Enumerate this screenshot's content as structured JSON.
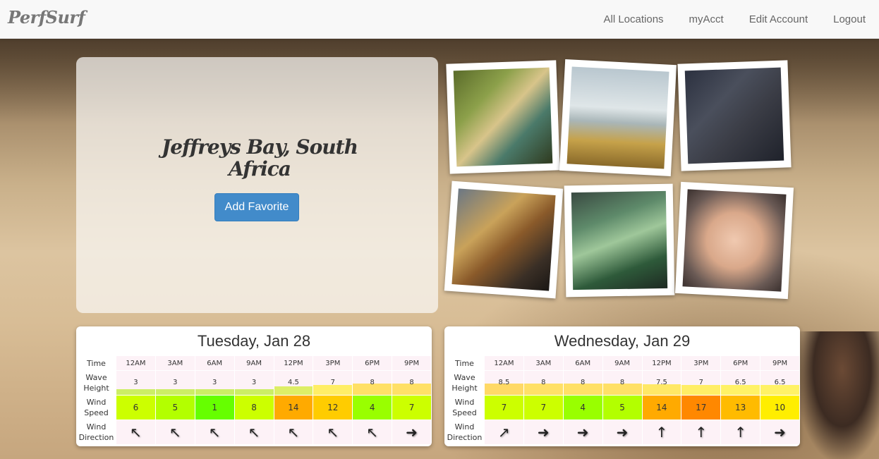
{
  "nav": {
    "brand": "PerfSurf",
    "links": [
      "All Locations",
      "myAcct",
      "Edit Account",
      "Logout"
    ]
  },
  "hero": {
    "location": "Jeffreys Bay, South Africa",
    "button_label": "Add Favorite"
  },
  "row_labels": {
    "time": "Time",
    "wave_height": "Wave Height",
    "wind_speed": "Wind Speed",
    "wind_direction": "Wind Direction"
  },
  "forecasts": [
    {
      "day": "Tuesday, Jan 28",
      "times": [
        "12AM",
        "3AM",
        "6AM",
        "9AM",
        "12PM",
        "3PM",
        "6PM",
        "9PM"
      ],
      "wave_heights": [
        "3",
        "3",
        "3",
        "3",
        "4.5",
        "7",
        "8",
        "8"
      ],
      "wind_speeds": [
        "6",
        "5",
        "1",
        "8",
        "14",
        "12",
        "4",
        "7"
      ],
      "wind_colors": [
        "#ccff00",
        "#b3ff00",
        "#66ff00",
        "#ccff00",
        "#ffaa00",
        "#ffcc00",
        "#99ff00",
        "#ccff00"
      ],
      "wave_colors": [
        "#ccee66",
        "#ccee66",
        "#ccee66",
        "#ccee66",
        "#ddee66",
        "#ffee66",
        "#ffe066",
        "#ffe066"
      ],
      "wind_direction_icons": [
        "arrow-up-left-icon",
        "arrow-up-left-icon",
        "arrow-up-left-icon",
        "arrow-up-left-icon",
        "arrow-up-left-icon",
        "arrow-up-left-icon",
        "arrow-up-left-icon",
        "arrow-right-icon"
      ]
    },
    {
      "day": "Wednesday, Jan 29",
      "times": [
        "12AM",
        "3AM",
        "6AM",
        "9AM",
        "12PM",
        "3PM",
        "6PM",
        "9PM"
      ],
      "wave_heights": [
        "8.5",
        "8",
        "8",
        "8",
        "7.5",
        "7",
        "6.5",
        "6.5"
      ],
      "wind_speeds": [
        "7",
        "7",
        "4",
        "5",
        "14",
        "17",
        "13",
        "10"
      ],
      "wind_colors": [
        "#ccff00",
        "#ccff00",
        "#99ff00",
        "#b3ff00",
        "#ffaa00",
        "#ff8800",
        "#ffbb00",
        "#ffee00"
      ],
      "wave_colors": [
        "#ffd966",
        "#ffe066",
        "#ffe066",
        "#ffe066",
        "#ffe866",
        "#ffee66",
        "#fff266",
        "#fff266"
      ],
      "wind_direction_icons": [
        "arrow-up-right-icon",
        "arrow-right-icon",
        "arrow-right-icon",
        "arrow-right-icon",
        "arrow-up-icon",
        "arrow-up-icon",
        "arrow-up-icon",
        "arrow-right-icon"
      ]
    }
  ]
}
